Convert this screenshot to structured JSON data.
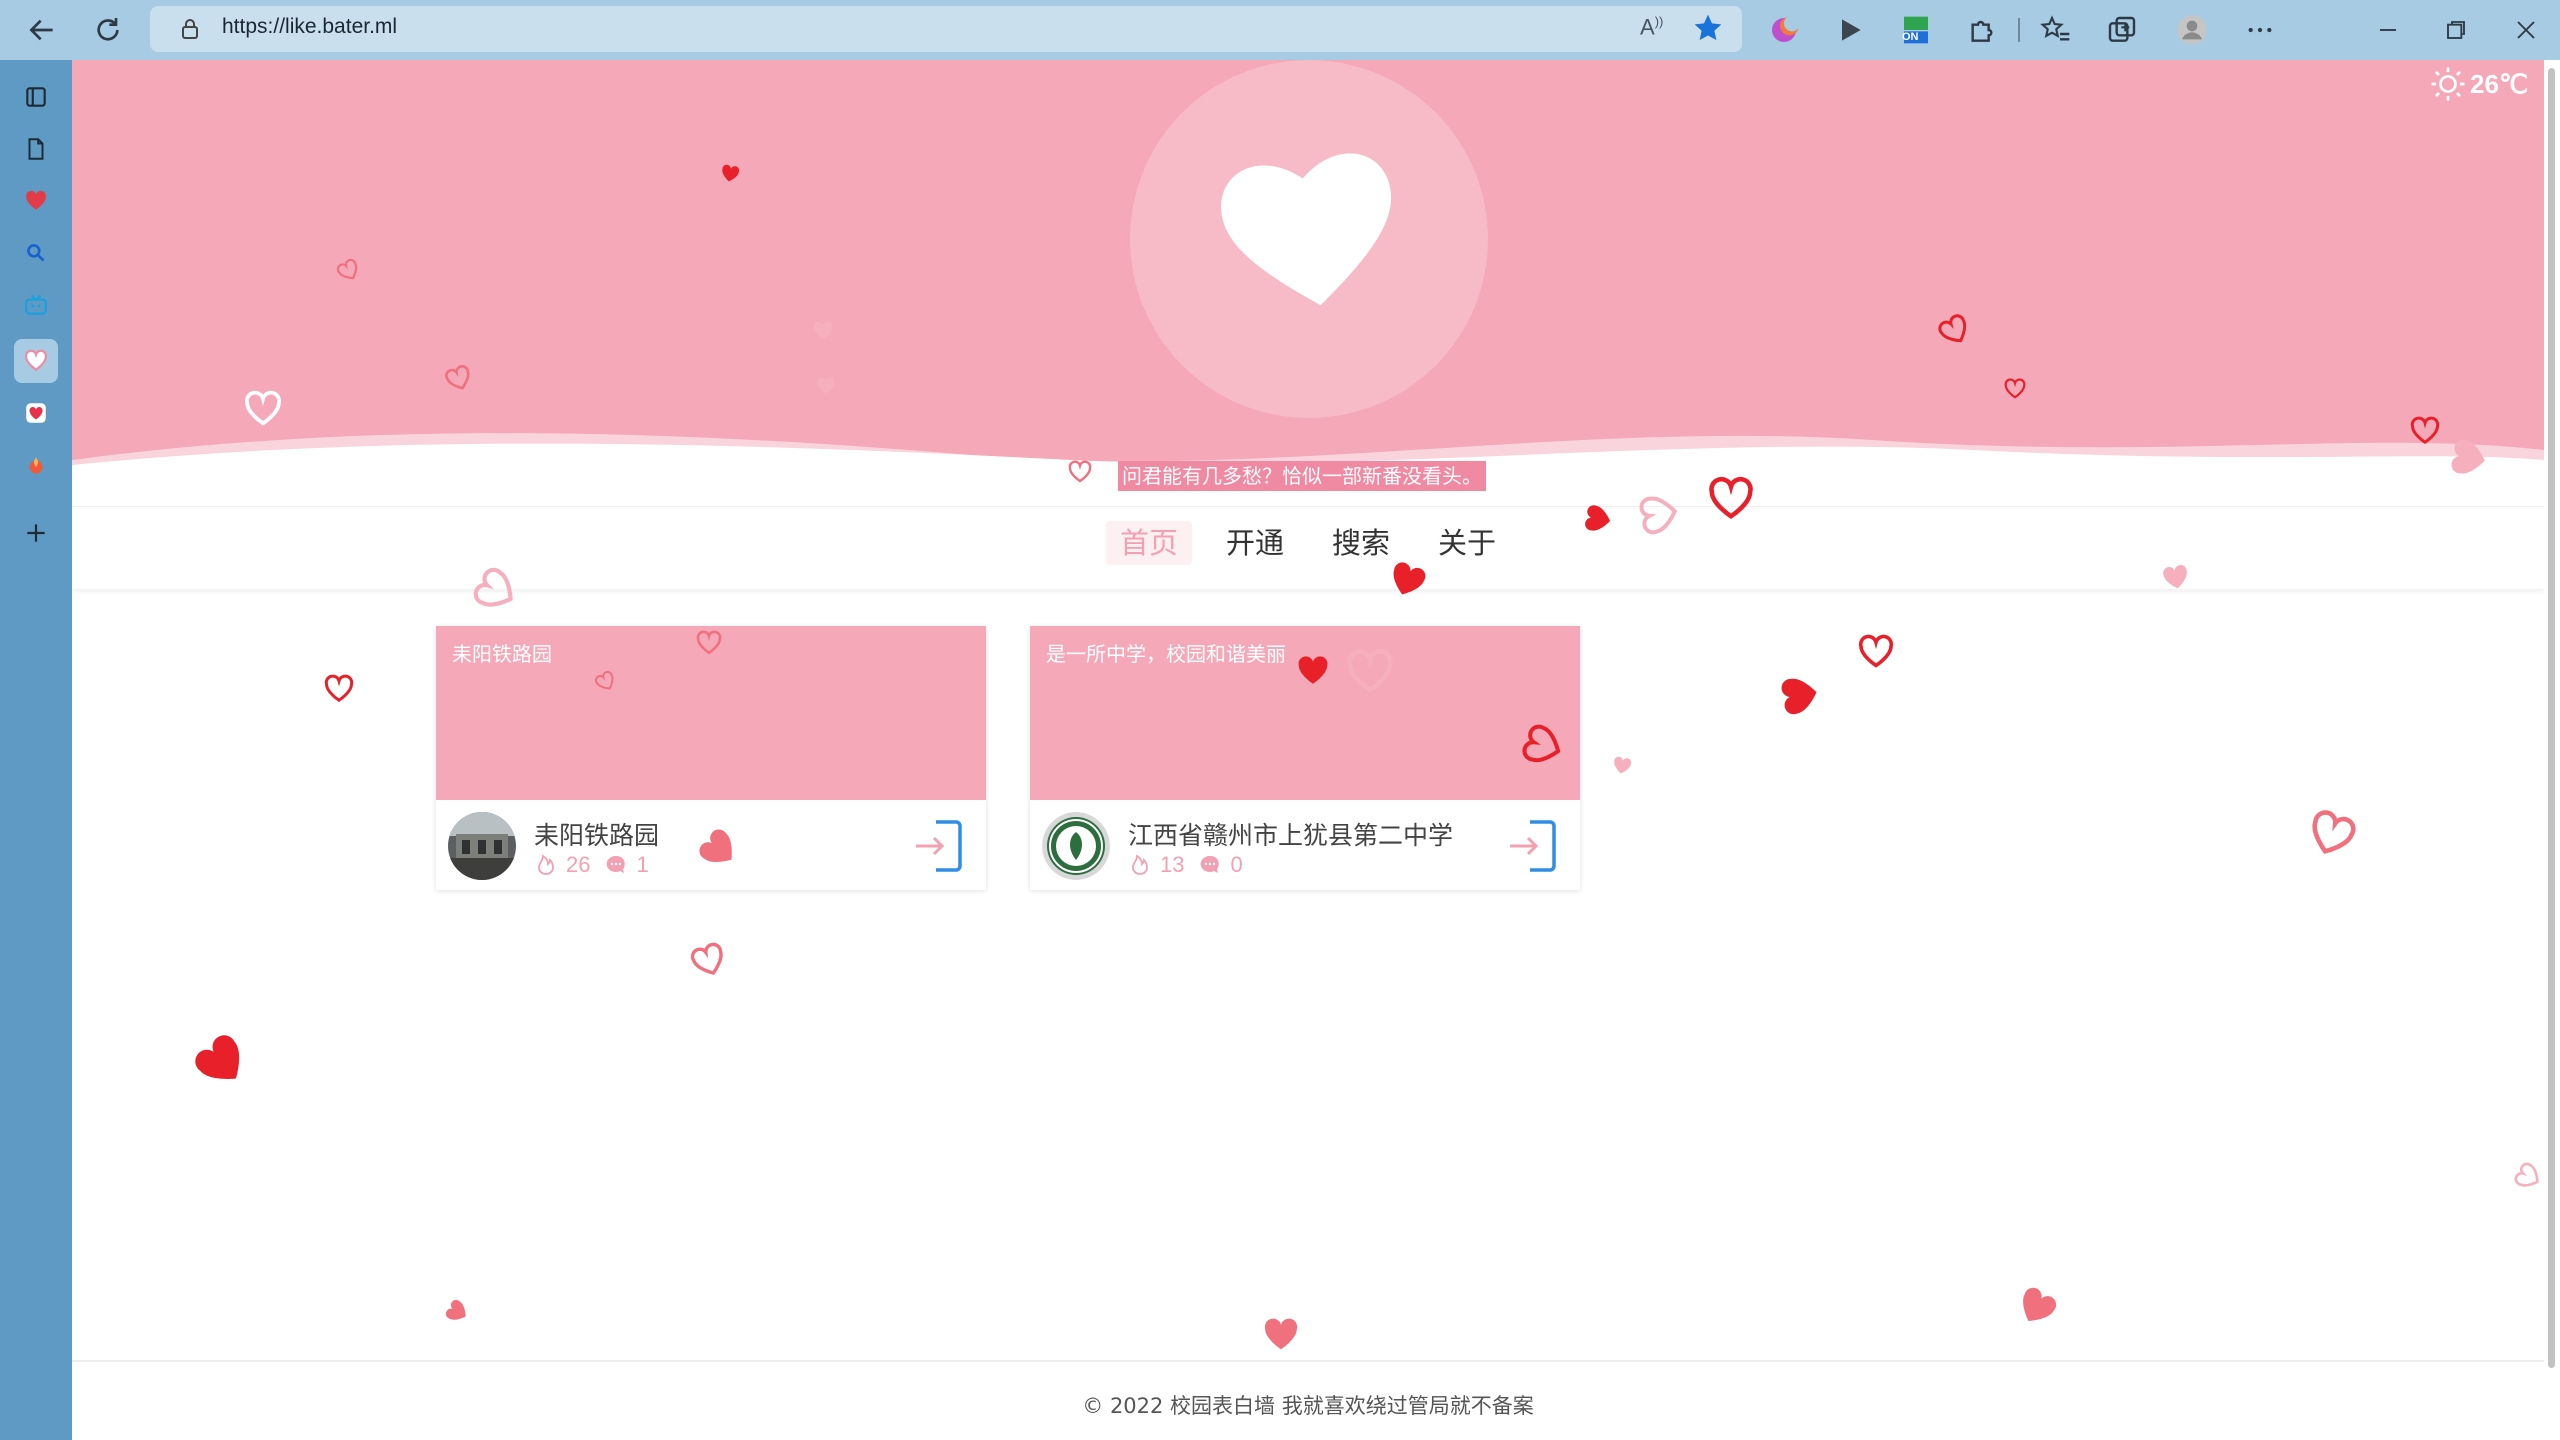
{
  "browser": {
    "url": "https://like.bater.ml",
    "read_aloud": "A⁾",
    "extension_badge": "ON"
  },
  "header": {
    "weather": "26℃",
    "motto": "问君能有几多愁？恰似一部新番没看头。"
  },
  "nav": {
    "items": [
      {
        "label": "首页",
        "active": true
      },
      {
        "label": "开通",
        "active": false
      },
      {
        "label": "搜索",
        "active": false
      },
      {
        "label": "关于",
        "active": false
      }
    ]
  },
  "cards": [
    {
      "cover_text": "耒阳铁路园",
      "name": "耒阳铁路园",
      "hot": "26",
      "comments": "1"
    },
    {
      "cover_text": "是一所中学，校园和谐美丽",
      "name": "江西省赣州市上犹县第二中学",
      "hot": "13",
      "comments": "0"
    }
  ],
  "footer": {
    "text": "© 2022 校园表白墙  我就喜欢绕过管局就不备案"
  },
  "colors": {
    "accent_pink": "#f4a8b8",
    "heart_red": "#e8202a",
    "enter_blue": "#2f8de4"
  }
}
